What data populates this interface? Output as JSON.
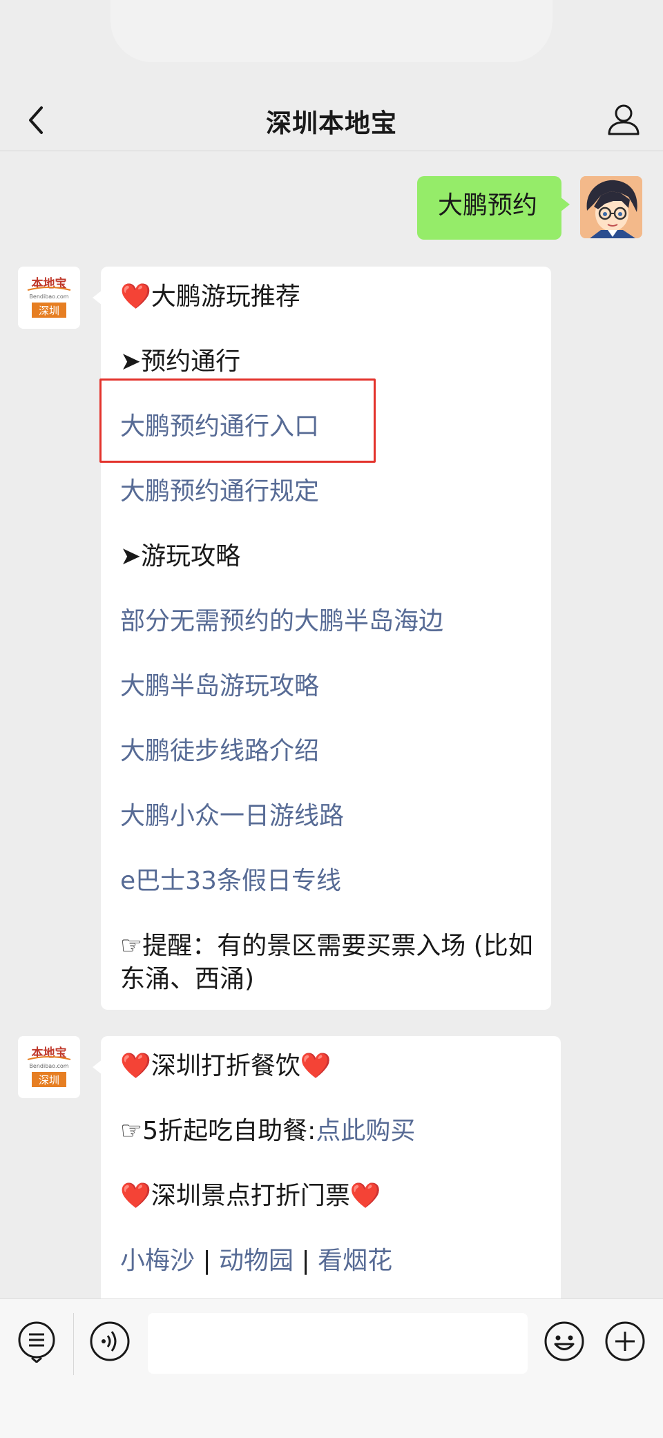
{
  "nav": {
    "title": "深圳本地宝"
  },
  "sent_message": {
    "text": "大鹏预约"
  },
  "logo": {
    "top": "本地宝",
    "middle": "Bendibao.com",
    "bottom": "深圳"
  },
  "reply1": {
    "title_heart": "❤️",
    "title": "大鹏游玩推荐",
    "section1": "➤预约通行",
    "link1": "大鹏预约通行入口",
    "link2": "大鹏预约通行规定",
    "section2": "➤游玩攻略",
    "link3": "部分无需预约的大鹏半岛海边",
    "link4": "大鹏半岛游玩攻略",
    "link5": "大鹏徒步线路介绍",
    "link6": "大鹏小众一日游线路",
    "link7": "e巴士33条假日专线",
    "reminder_line1": "☞提醒：有的景区需要买票入场 (比如",
    "reminder_line2": "东涌、西涌)"
  },
  "reply2": {
    "heading1": "深圳打折餐饮",
    "buffet_prefix": "☞5折起吃自助餐:",
    "buffet_link": "点此购买",
    "heading2": "深圳景点打折门票",
    "ticket_links": [
      "小梅沙",
      "动物园",
      "看烟花"
    ],
    "separator": " | ",
    "heart": "❤️"
  },
  "input": {
    "placeholder": ""
  },
  "colors": {
    "link": "#576b95",
    "sent_bubble": "#95ec69",
    "highlight": "#e3322b",
    "background": "#ededed"
  }
}
